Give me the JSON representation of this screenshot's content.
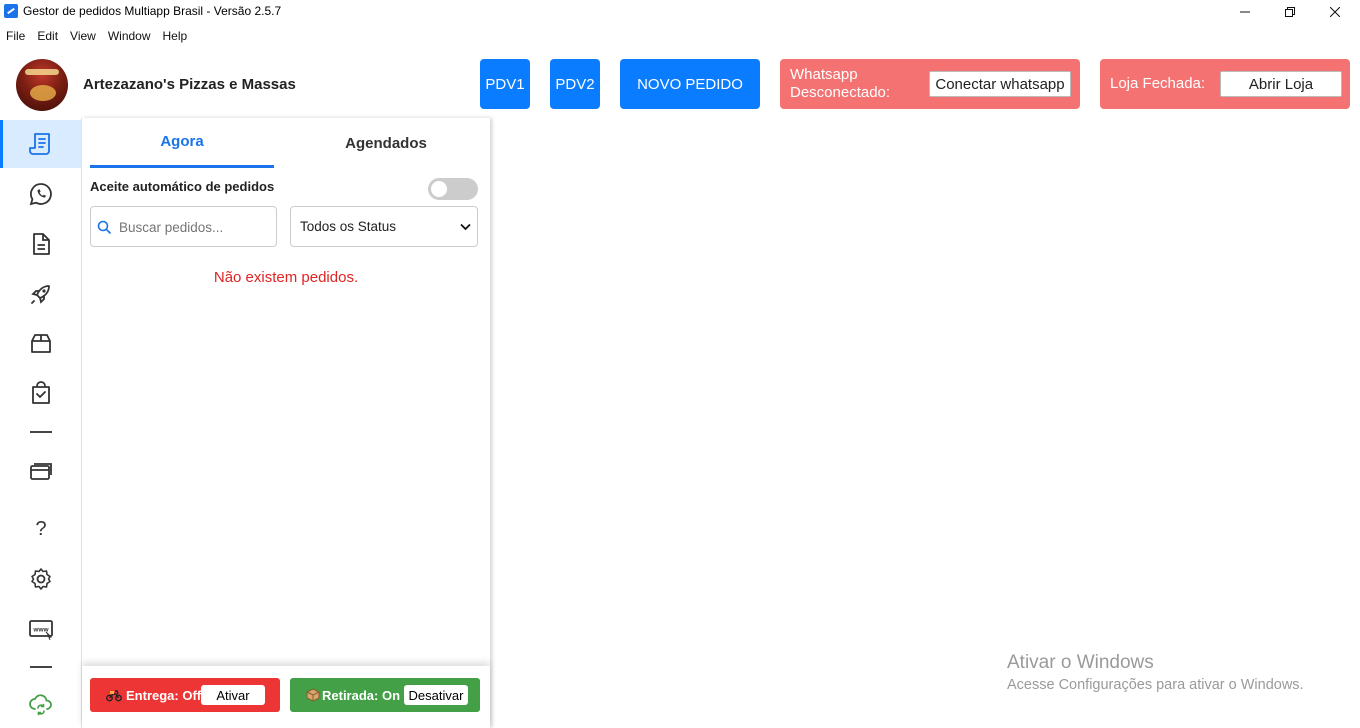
{
  "window": {
    "title": "Gestor de pedidos Multiapp Brasil - Versão 2.5.7",
    "minimize": "—",
    "restore": "❐",
    "close": "✕"
  },
  "menu": [
    "File",
    "Edit",
    "View",
    "Window",
    "Help"
  ],
  "header": {
    "store_name": "Artezazano's Pizzas e Massas",
    "pdv1": "PDV1",
    "pdv2": "PDV2",
    "new_order": "NOVO PEDIDO",
    "whatsapp_status": "Whatsapp Desconectado:",
    "whatsapp_line1": "Whatsapp",
    "whatsapp_line2": "Desconectado:",
    "connect_whatsapp": "Conectar whatsapp",
    "store_status": "Loja Fechada:",
    "open_store": "Abrir Loja",
    "colors": {
      "primary": "#0a7cff",
      "alert": "#f47272"
    }
  },
  "sidebar": {
    "items": [
      {
        "icon": "orders-receipt-icon",
        "active": true
      },
      {
        "icon": "whatsapp-icon"
      },
      {
        "icon": "document-icon"
      },
      {
        "icon": "rocket-icon"
      },
      {
        "icon": "package-box-icon"
      },
      {
        "icon": "clipboard-bag-icon"
      },
      {
        "icon": "credit-card-icon"
      },
      {
        "icon": "help-question-icon",
        "glyph": "?"
      },
      {
        "icon": "settings-gear-icon"
      },
      {
        "icon": "www-browser-icon"
      },
      {
        "icon": "cloud-sync-icon"
      }
    ]
  },
  "orders": {
    "tabs": [
      {
        "label": "Agora",
        "active": true
      },
      {
        "label": "Agendados",
        "active": false
      }
    ],
    "auto_accept_label": "Aceite automático de pedidos",
    "auto_accept_on": false,
    "search_placeholder": "Buscar pedidos...",
    "status_filter": "Todos os Status",
    "empty_message": "Não existem pedidos."
  },
  "footer": {
    "delivery_label": "Entrega: Off",
    "delivery_action": "Ativar",
    "pickup_label": "Retirada: On",
    "pickup_action": "Desativar",
    "colors": {
      "delivery": "#ee3535",
      "pickup": "#43a047"
    }
  },
  "watermark": {
    "line1": "Ativar o Windows",
    "line2": "Acesse Configurações para ativar o Windows."
  }
}
